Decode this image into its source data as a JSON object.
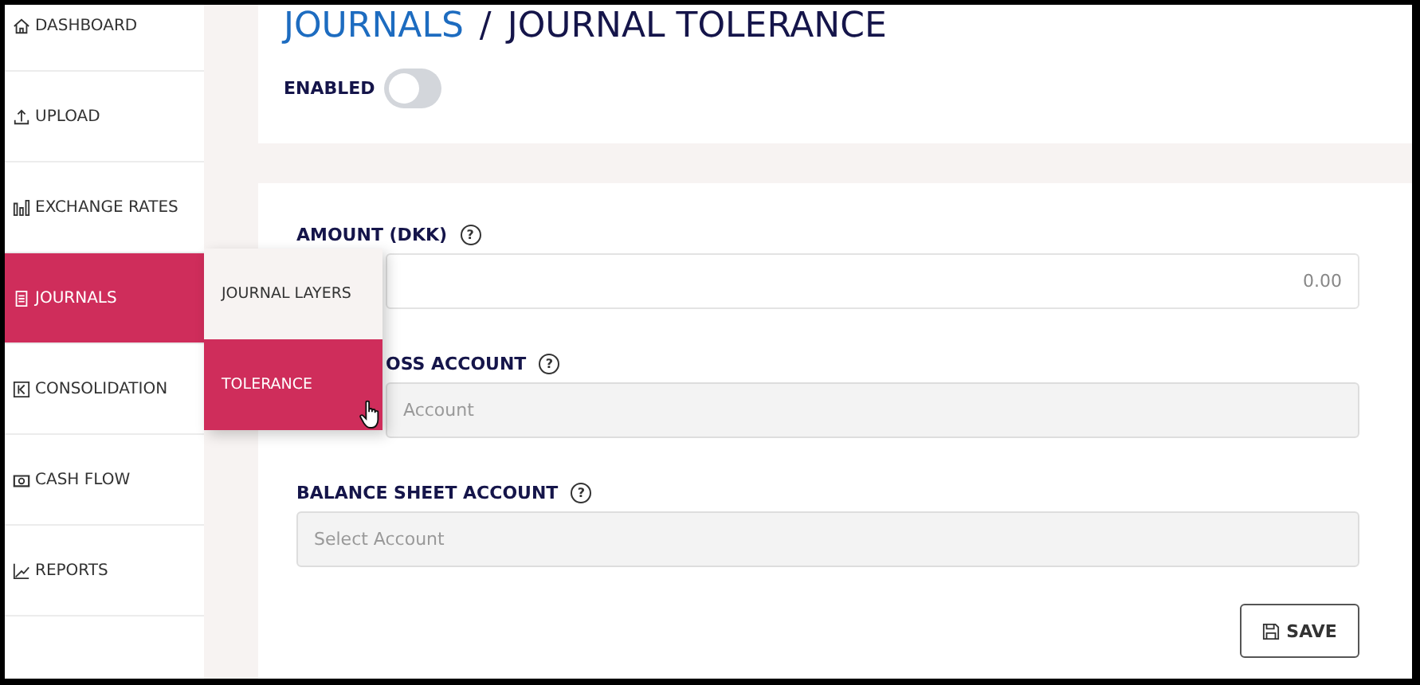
{
  "sidebar": {
    "items": [
      {
        "label": "DASHBOARD",
        "selected": false
      },
      {
        "label": "UPLOAD",
        "selected": false
      },
      {
        "label": "EXCHANGE RATES",
        "selected": false
      },
      {
        "label": "JOURNALS",
        "selected": true
      },
      {
        "label": "CONSOLIDATION",
        "selected": false
      },
      {
        "label": "CASH FLOW",
        "selected": false
      },
      {
        "label": "REPORTS",
        "selected": false
      }
    ]
  },
  "submenu": {
    "items": [
      {
        "label": "JOURNAL LAYERS",
        "selected": false
      },
      {
        "label": "TOLERANCE",
        "selected": true
      }
    ]
  },
  "header": {
    "breadcrumb": [
      {
        "label": "JOURNALS",
        "kind": "link"
      },
      {
        "label": "JOURNAL TOLERANCE",
        "kind": "current"
      }
    ],
    "separator": "/",
    "toggle": {
      "label": "ENABLED",
      "on": false
    }
  },
  "form": {
    "fields": [
      {
        "label": "AMOUNT (DKK)",
        "help": "?",
        "kind": "input",
        "value": "0.00",
        "label_covered": false,
        "field_covered": true
      },
      {
        "label": "OSS ACCOUNT",
        "help": "?",
        "kind": "select",
        "placeholder": "Account",
        "label_covered": true,
        "field_covered": true
      },
      {
        "label": "BALANCE SHEET ACCOUNT",
        "help": "?",
        "kind": "select",
        "placeholder": "Select Account",
        "label_covered": false,
        "field_covered": false
      }
    ],
    "save_button": {
      "label": "SAVE"
    }
  }
}
